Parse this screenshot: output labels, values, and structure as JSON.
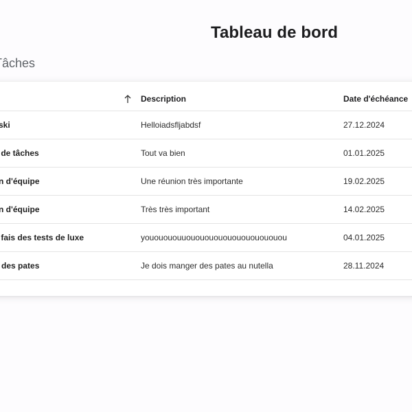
{
  "header": {
    "title": "Tableau de bord"
  },
  "section": {
    "title": "Tâches"
  },
  "table": {
    "columns": {
      "sort_icon": "arrow-up-icon",
      "description": "Description",
      "due_date": "Date d'échéance"
    },
    "rows": [
      {
        "title": "du ski",
        "description": "Helloiadsfljabdsf",
        "due_date": "27.12.2024"
      },
      {
        "title": "ion de tâches",
        "description": "Tout va bien",
        "due_date": "01.01.2025"
      },
      {
        "title": "nion d'équipe",
        "description": "Une réunion très importante",
        "due_date": "19.02.2025"
      },
      {
        "title": "nion d'équipe",
        "description": "Très très important",
        "due_date": "14.02.2025"
      },
      {
        "title": "r je fais des tests de luxe",
        "description": "yououououuououououououououououou",
        "due_date": "04.01.2025"
      },
      {
        "title": "ger des pates",
        "description": "Je dois manger des pates au nutella",
        "due_date": "28.11.2024"
      }
    ]
  }
}
